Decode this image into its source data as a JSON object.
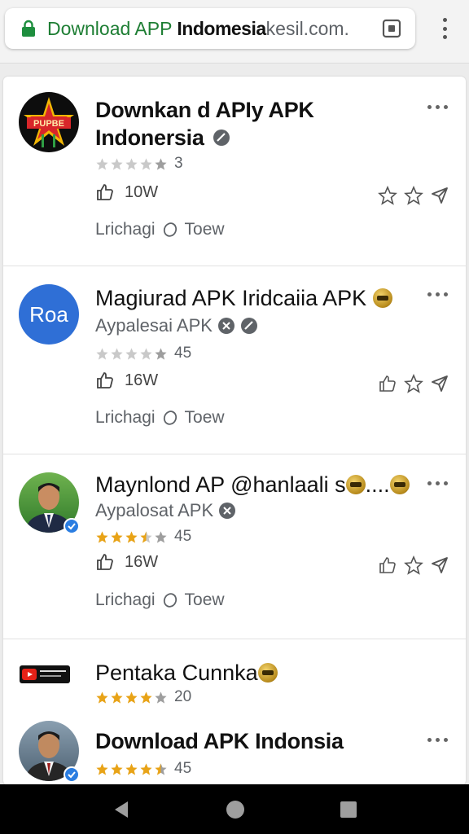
{
  "browser": {
    "url_domain_green": "Download APP",
    "url_domain_bold": "Indomesia",
    "url_domain_rest": "kesil.com.",
    "lock_icon": "lock-icon",
    "tab_icon": "tab-switcher-icon",
    "menu_icon": "vertical-more-icon"
  },
  "items": [
    {
      "title_line1": "Downkan d APIy APK",
      "title_line2": "Indonersia",
      "avatar_text": "PUPBE",
      "rating_count": "3",
      "stars_filled": 0,
      "likes": "10W",
      "meta_left": "Lrichagi",
      "meta_right": "Toew"
    },
    {
      "title": "Magiurad APK Iridcaiia APK",
      "avatar_text": "Roa",
      "subtitle": "Aypalesai APK",
      "rating_count": "45",
      "stars_filled": 0,
      "likes": "16W",
      "meta_left": "Lrichagi",
      "meta_right": "Toew"
    },
    {
      "title": "Maynlond AP @hanlaali s",
      "title_tail": "....",
      "subtitle": "Aypalosat APK",
      "rating_count": "45",
      "stars_filled": 3.5,
      "likes": "16W",
      "meta_left": "Lrichagi",
      "meta_right": "Toew"
    },
    {
      "title": "Pentaka Cunnka",
      "rating_count": "20",
      "stars_filled": 4
    },
    {
      "title": "Download APK Indonsia",
      "rating_count": "45",
      "stars_filled": 4.5
    }
  ],
  "colors": {
    "star_gold": "#e8a317",
    "star_grey": "#c9c9c9",
    "lock_green": "#1e8e3e",
    "roa_blue": "#2f6fd6"
  }
}
